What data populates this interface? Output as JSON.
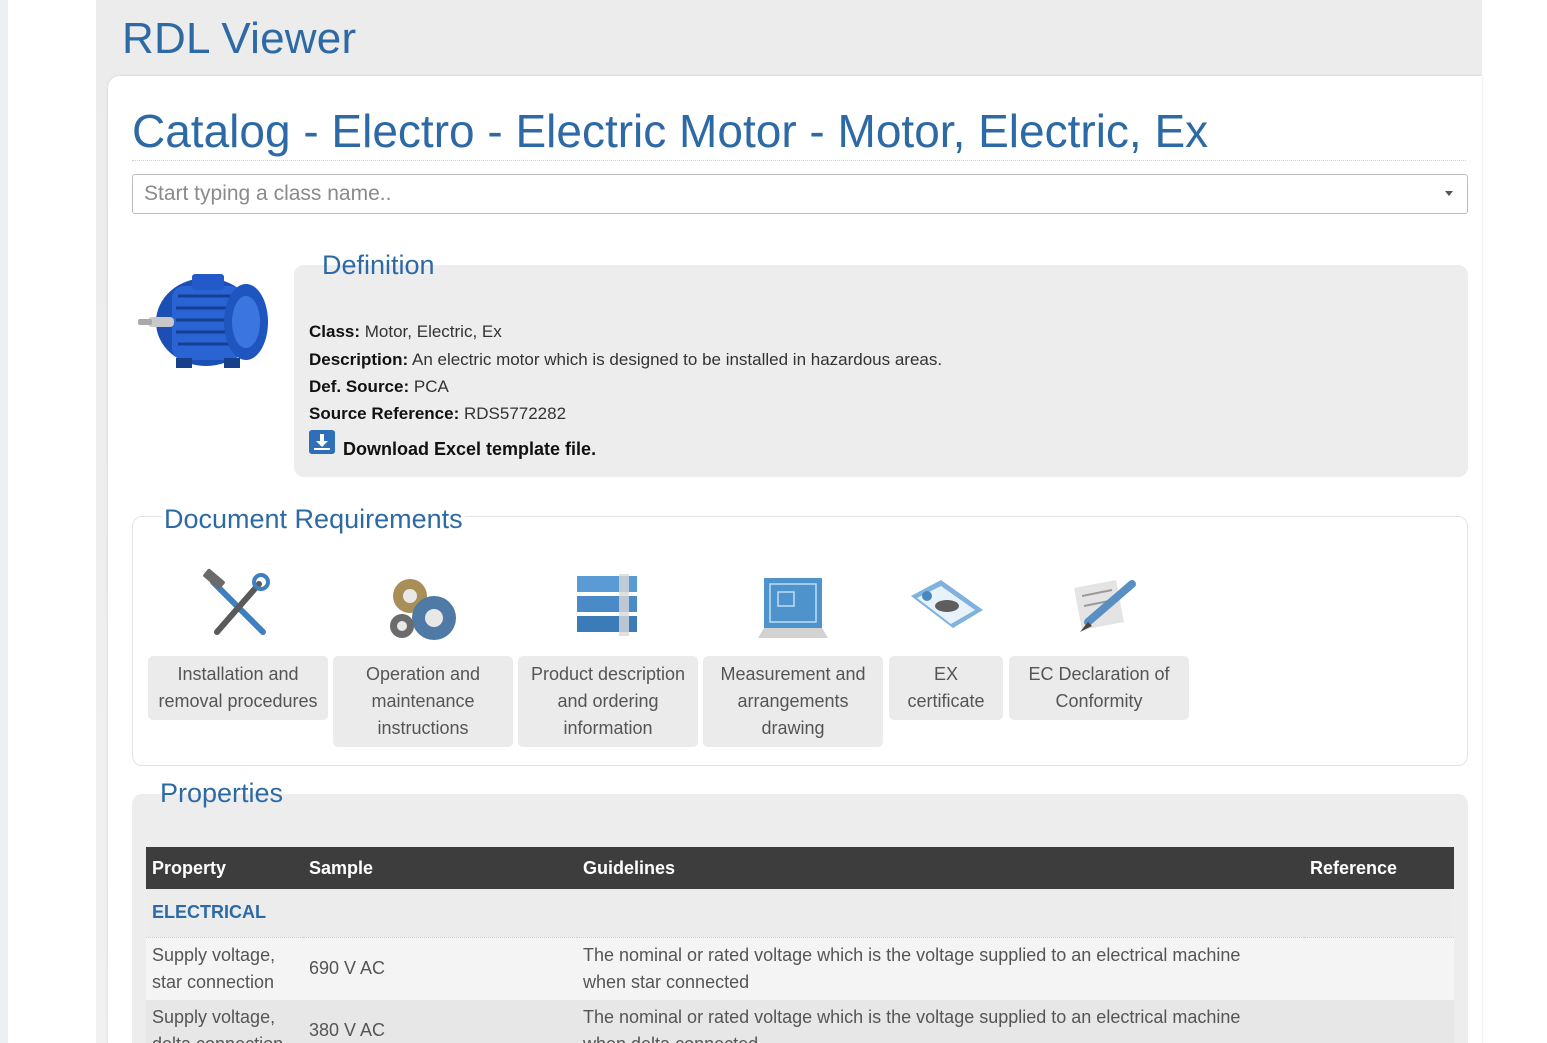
{
  "app": {
    "title": "RDL Viewer"
  },
  "page": {
    "title": "Catalog - Electro - Electric Motor - Motor, Electric, Ex"
  },
  "class_search": {
    "placeholder": "Start typing a class name.."
  },
  "definition": {
    "heading": "Definition",
    "image_icon": "electric-motor-image",
    "fields": [
      {
        "label": "Class:",
        "value": "Motor, Electric, Ex"
      },
      {
        "label": "Description:",
        "value": "An electric motor which is designed to be installed in hazardous areas."
      },
      {
        "label": "Def. Source:",
        "value": "PCA"
      },
      {
        "label": "Source Reference:",
        "value": "RDS5772282"
      }
    ],
    "download": {
      "icon": "download-icon",
      "label": "Download Excel template file."
    }
  },
  "document_requirements": {
    "heading": "Document Requirements",
    "items": [
      {
        "icon": "tools-icon",
        "line1": "Installation and",
        "line2": "removal procedures",
        "line3": ""
      },
      {
        "icon": "gears-icon",
        "line1": "Operation and",
        "line2": "maintenance",
        "line3": "instructions"
      },
      {
        "icon": "binders-icon",
        "line1": "Product description",
        "line2": "and ordering",
        "line3": "information"
      },
      {
        "icon": "blueprint-icon",
        "line1": "Measurement and",
        "line2": "arrangements",
        "line3": "drawing"
      },
      {
        "icon": "certificate-icon",
        "line1": "EX certificate",
        "line2": "",
        "line3": ""
      },
      {
        "icon": "signature-pen-icon",
        "line1": "EC Declaration of",
        "line2": "Conformity",
        "line3": ""
      }
    ]
  },
  "properties": {
    "heading": "Properties",
    "columns": [
      "Property",
      "Sample",
      "Guidelines",
      "Reference"
    ],
    "groups": [
      {
        "name": "ELECTRICAL",
        "rows": [
          {
            "property_line1": "Supply voltage,",
            "property_line2": "star connection",
            "sample": "690 V AC",
            "guideline_line1": "The nominal or rated voltage which is the voltage supplied to an electrical machine",
            "guideline_line2": "when star connected",
            "reference": ""
          },
          {
            "property_line1": "Supply voltage,",
            "property_line2": "delta connection",
            "sample": "380 V AC",
            "guideline_line1": "The nominal or rated voltage which is the voltage supplied to an electrical machine",
            "guideline_line2": "when delta connected",
            "reference": ""
          }
        ]
      }
    ]
  },
  "colors": {
    "accent": "#2d6aa5",
    "table_header": "#3d3d3d",
    "panel_gray": "#ededed"
  }
}
